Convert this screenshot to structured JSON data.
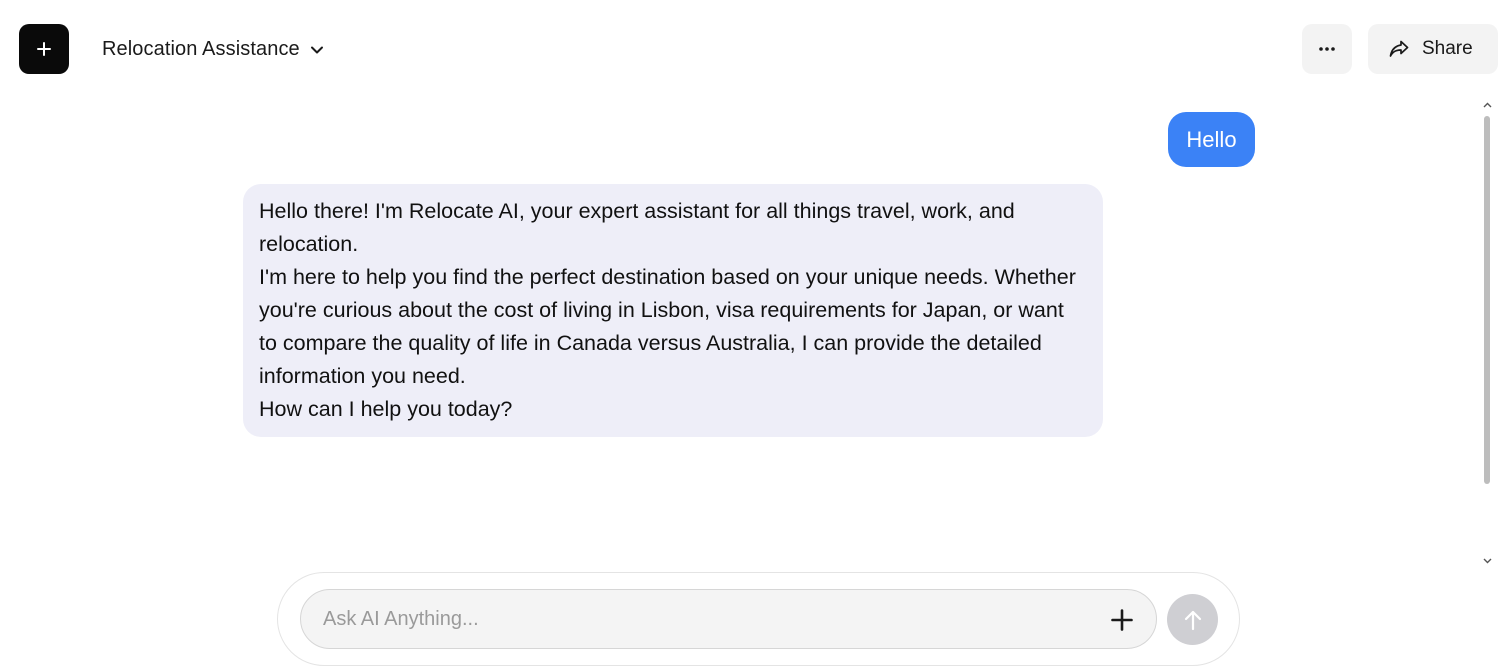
{
  "header": {
    "new_chat_icon": "plus-icon",
    "title": "Relocation Assistance",
    "title_dropdown_icon": "chevron-down-icon",
    "more_icon": "ellipsis-icon",
    "share_label": "Share",
    "share_icon": "share-arrow-icon"
  },
  "messages": [
    {
      "role": "user",
      "text": "Hello"
    },
    {
      "role": "assistant",
      "lines": [
        "Hello there! I'm Relocate AI, your expert assistant for all things travel, work, and relocation.",
        "I'm here to help you find the perfect destination based on your unique needs. Whether you're curious about the cost of living in Lisbon, visa requirements for Japan, or want to compare the quality of life in Canada versus Australia, I can provide the detailed information you need.",
        "How can I help you today?"
      ]
    }
  ],
  "composer": {
    "placeholder": "Ask AI Anything...",
    "value": "",
    "attach_icon": "plus-icon",
    "send_icon": "arrow-up-icon"
  },
  "colors": {
    "user_bubble": "#3b82f6",
    "assistant_bubble": "#eeeef8",
    "send_button_disabled": "#cfcfd3",
    "primary_button": "#0a0a0a"
  }
}
